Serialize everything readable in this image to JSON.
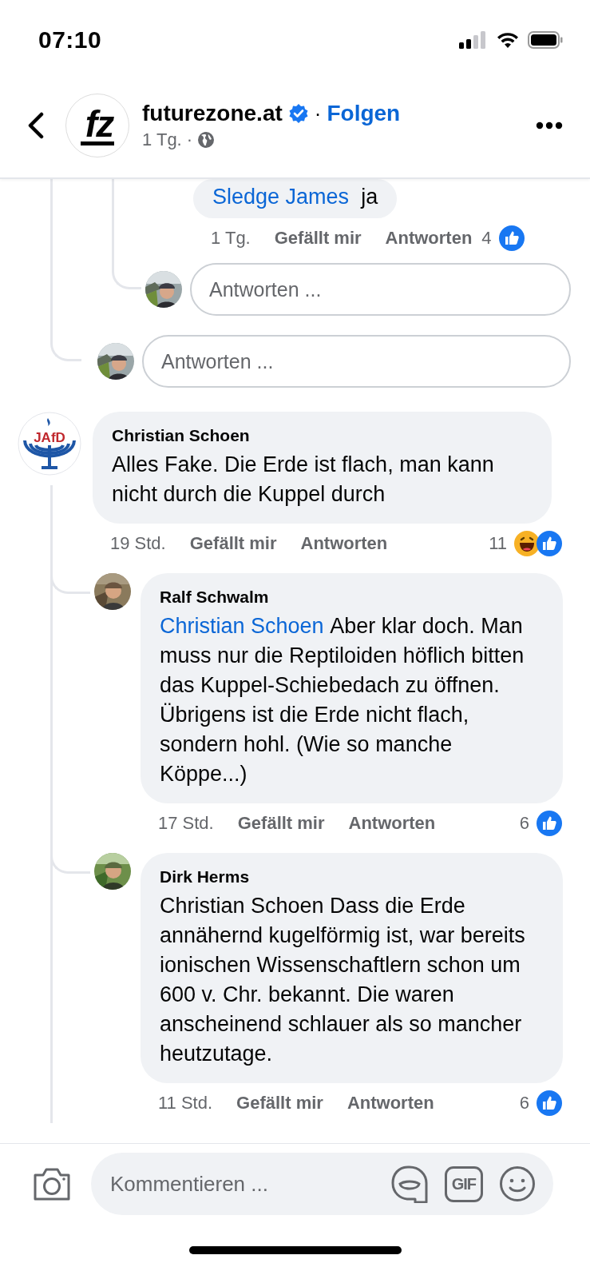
{
  "status_bar": {
    "time": "07:10"
  },
  "header": {
    "logo_text": "fz",
    "page_name": "futurezone.at",
    "verified": true,
    "separator": "·",
    "follow_label": "Folgen",
    "post_age": "1 Tg.",
    "age_separator": "·"
  },
  "top_thread": {
    "partial_reply": {
      "mention": "Sledge James",
      "text": "ja",
      "time": "1 Tg.",
      "like_label": "Gefällt mir",
      "reply_label": "Antworten",
      "reaction_count": "4",
      "reactions": [
        {
          "kind": "like"
        }
      ]
    },
    "reply_fields": [
      {
        "placeholder": "Antworten ..."
      },
      {
        "placeholder": "Antworten ..."
      }
    ]
  },
  "comments": [
    {
      "author": "Christian Schoen",
      "avatar": {
        "kind": "logo",
        "text": "JAfD"
      },
      "text": "Alles Fake. Die Erde ist flach, man kann nicht durch die Kuppel durch",
      "time": "19 Std.",
      "like_label": "Gefällt mir",
      "reply_label": "Antworten",
      "reaction_count": "11",
      "reactions": [
        {
          "kind": "haha"
        },
        {
          "kind": "like"
        }
      ],
      "replies": [
        {
          "author": "Ralf Schwalm",
          "mention": "Christian Schoen",
          "text": "Aber klar doch. Man muss nur die Reptiloiden höflich bitten das Kuppel-Schiebedach zu öffnen. Übrigens ist die Erde nicht flach, sondern hohl. (Wie so manche Köppe...)",
          "time": "17 Std.",
          "like_label": "Gefällt mir",
          "reply_label": "Antworten",
          "reaction_count": "6",
          "reactions": [
            {
              "kind": "like"
            }
          ]
        },
        {
          "author": "Dirk Herms",
          "text": "Christian Schoen Dass die Erde annähernd kugelförmig ist, war bereits ionischen Wissenschaftlern schon um 600 v. Chr. bekannt. Die waren anscheinend schlauer als so mancher heutzutage.",
          "time": "11 Std.",
          "like_label": "Gefällt mir",
          "reply_label": "Antworten",
          "reaction_count": "6",
          "reactions": [
            {
              "kind": "like"
            }
          ]
        }
      ]
    }
  ],
  "composer": {
    "placeholder": "Kommentieren ...",
    "gif_label": "GIF"
  }
}
